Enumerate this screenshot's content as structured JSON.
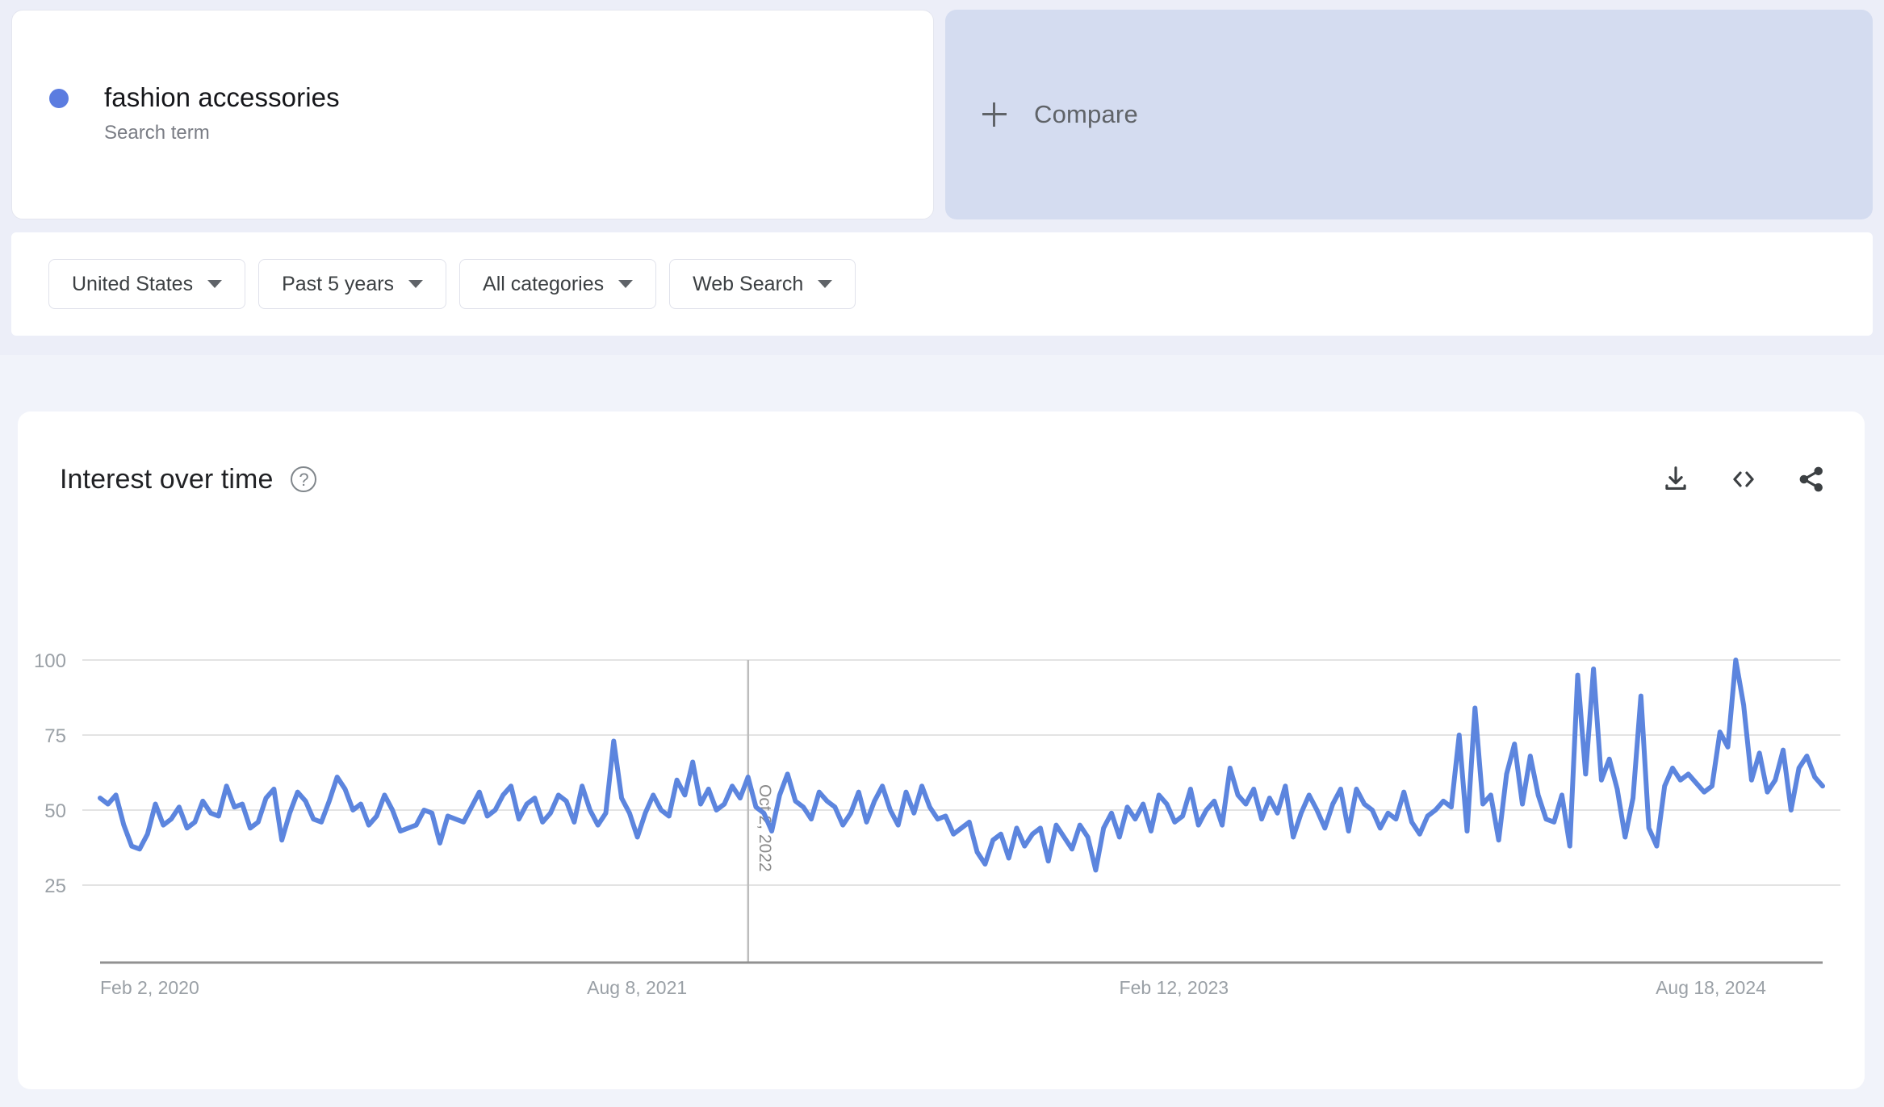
{
  "search_terms": [
    {
      "label": "fashion accessories",
      "type_label": "Search term",
      "color": "#5b7ce0"
    }
  ],
  "compare": {
    "label": "Compare",
    "icon": "plus-icon"
  },
  "filters": [
    {
      "name": "location",
      "value": "United States"
    },
    {
      "name": "time-range",
      "value": "Past 5 years"
    },
    {
      "name": "category",
      "value": "All categories"
    },
    {
      "name": "search-type",
      "value": "Web Search"
    }
  ],
  "chart_panel": {
    "title": "Interest over time",
    "help_icon": "?",
    "actions": [
      {
        "name": "download-icon",
        "tooltip": "Download"
      },
      {
        "name": "embed-icon",
        "tooltip": "Embed"
      },
      {
        "name": "share-icon",
        "tooltip": "Share"
      }
    ]
  },
  "chart_data": {
    "type": "line",
    "title": "Interest over time",
    "xlabel": "",
    "ylabel": "",
    "ylim": [
      0,
      100
    ],
    "yticks": [
      25,
      50,
      75,
      100
    ],
    "grid": true,
    "legend": false,
    "series_color": "#5c85de",
    "x_tick_labels": [
      "Feb 2, 2020",
      "Aug 8, 2021",
      "Feb 12, 2023",
      "Aug 18, 2024"
    ],
    "x_tick_fractions": [
      0.0,
      0.3117,
      0.6234,
      0.9351
    ],
    "annotation_line": {
      "fraction": 0.3762,
      "label": "Oct 2, 2022",
      "orientation": "vertical"
    },
    "series": [
      {
        "name": "fashion accessories",
        "values": [
          54,
          52,
          55,
          45,
          38,
          37,
          42,
          52,
          45,
          47,
          51,
          44,
          46,
          53,
          49,
          48,
          58,
          51,
          52,
          44,
          46,
          54,
          57,
          40,
          49,
          56,
          53,
          47,
          46,
          53,
          61,
          57,
          50,
          52,
          45,
          48,
          55,
          50,
          43,
          44,
          45,
          50,
          49,
          39,
          48,
          47,
          46,
          51,
          56,
          48,
          50,
          55,
          58,
          47,
          52,
          54,
          46,
          49,
          55,
          53,
          46,
          58,
          50,
          45,
          49,
          73,
          54,
          49,
          41,
          49,
          55,
          50,
          48,
          60,
          55,
          66,
          52,
          57,
          50,
          52,
          58,
          54,
          61,
          51,
          49,
          43,
          55,
          62,
          53,
          51,
          47,
          56,
          53,
          51,
          45,
          49,
          56,
          46,
          53,
          58,
          50,
          45,
          56,
          49,
          58,
          51,
          47,
          48,
          42,
          44,
          46,
          36,
          32,
          40,
          42,
          34,
          44,
          38,
          42,
          44,
          33,
          45,
          41,
          37,
          45,
          41,
          30,
          44,
          49,
          41,
          51,
          47,
          52,
          43,
          55,
          52,
          46,
          48,
          57,
          45,
          50,
          53,
          45,
          64,
          55,
          52,
          57,
          47,
          54,
          49,
          58,
          41,
          49,
          55,
          50,
          44,
          52,
          57,
          43,
          57,
          52,
          50,
          44,
          49,
          47,
          56,
          46,
          42,
          48,
          50,
          53,
          51,
          75,
          43,
          84,
          52,
          55,
          40,
          62,
          72,
          52,
          68,
          55,
          47,
          46,
          55,
          38,
          95,
          62,
          97,
          60,
          67,
          57,
          41,
          54,
          88,
          44,
          38,
          58,
          64,
          60,
          62,
          59,
          56,
          58,
          76,
          71,
          100,
          85,
          60,
          69,
          56,
          60,
          70,
          50,
          64,
          68,
          61,
          58
        ]
      }
    ]
  }
}
